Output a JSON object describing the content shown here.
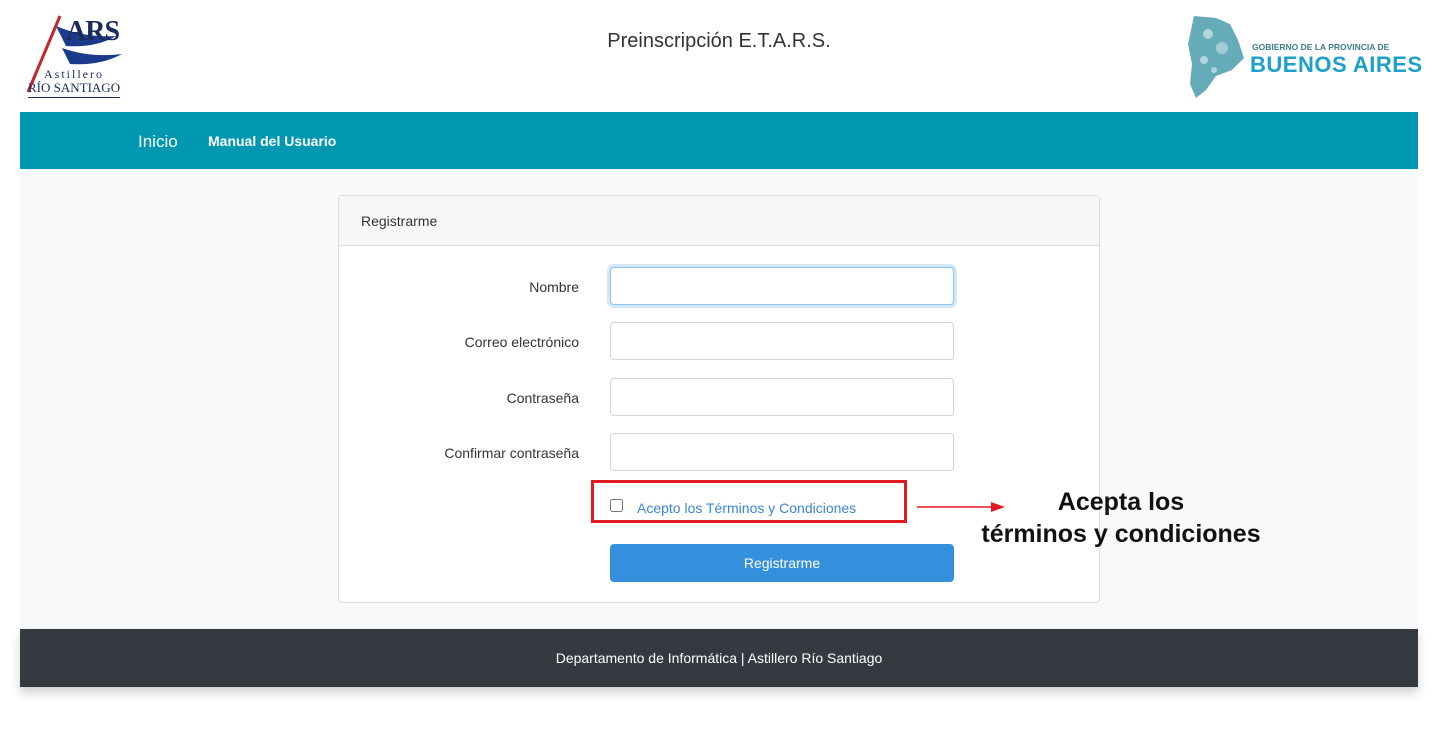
{
  "header": {
    "title": "Preinscripción E.T.A.R.S.",
    "left_logo": {
      "mark": "ARS",
      "line1": "Astillero",
      "line2": "RÍO SANTIAGO"
    },
    "right_logo": {
      "line1": "GOBIERNO DE LA PROVINCIA DE",
      "line2": "BUENOS AIRES"
    }
  },
  "nav": {
    "items": [
      {
        "label": "Inicio"
      },
      {
        "label": "Manual del Usuario"
      }
    ]
  },
  "card": {
    "title": "Registrarme",
    "fields": [
      {
        "label": "Nombre",
        "value": "",
        "placeholder": ""
      },
      {
        "label": "Correo electrónico",
        "value": "",
        "placeholder": ""
      },
      {
        "label": "Contraseña",
        "value": "",
        "placeholder": ""
      },
      {
        "label": "Confirmar contraseña",
        "value": "",
        "placeholder": ""
      }
    ],
    "terms_label": "Acepto los Términos y Condiciones",
    "terms_checked": false,
    "submit_label": "Registrarme"
  },
  "annotation": {
    "line1": "Acepta los",
    "line2": "términos y condiciones",
    "color": "#e01b22"
  },
  "footer": {
    "text": "Departamento de Informática | Astillero Río Santiago"
  },
  "colors": {
    "navbar": "#0098b0",
    "primary_button": "#3490dc",
    "footer": "#343a40",
    "link": "#3a85d6"
  }
}
